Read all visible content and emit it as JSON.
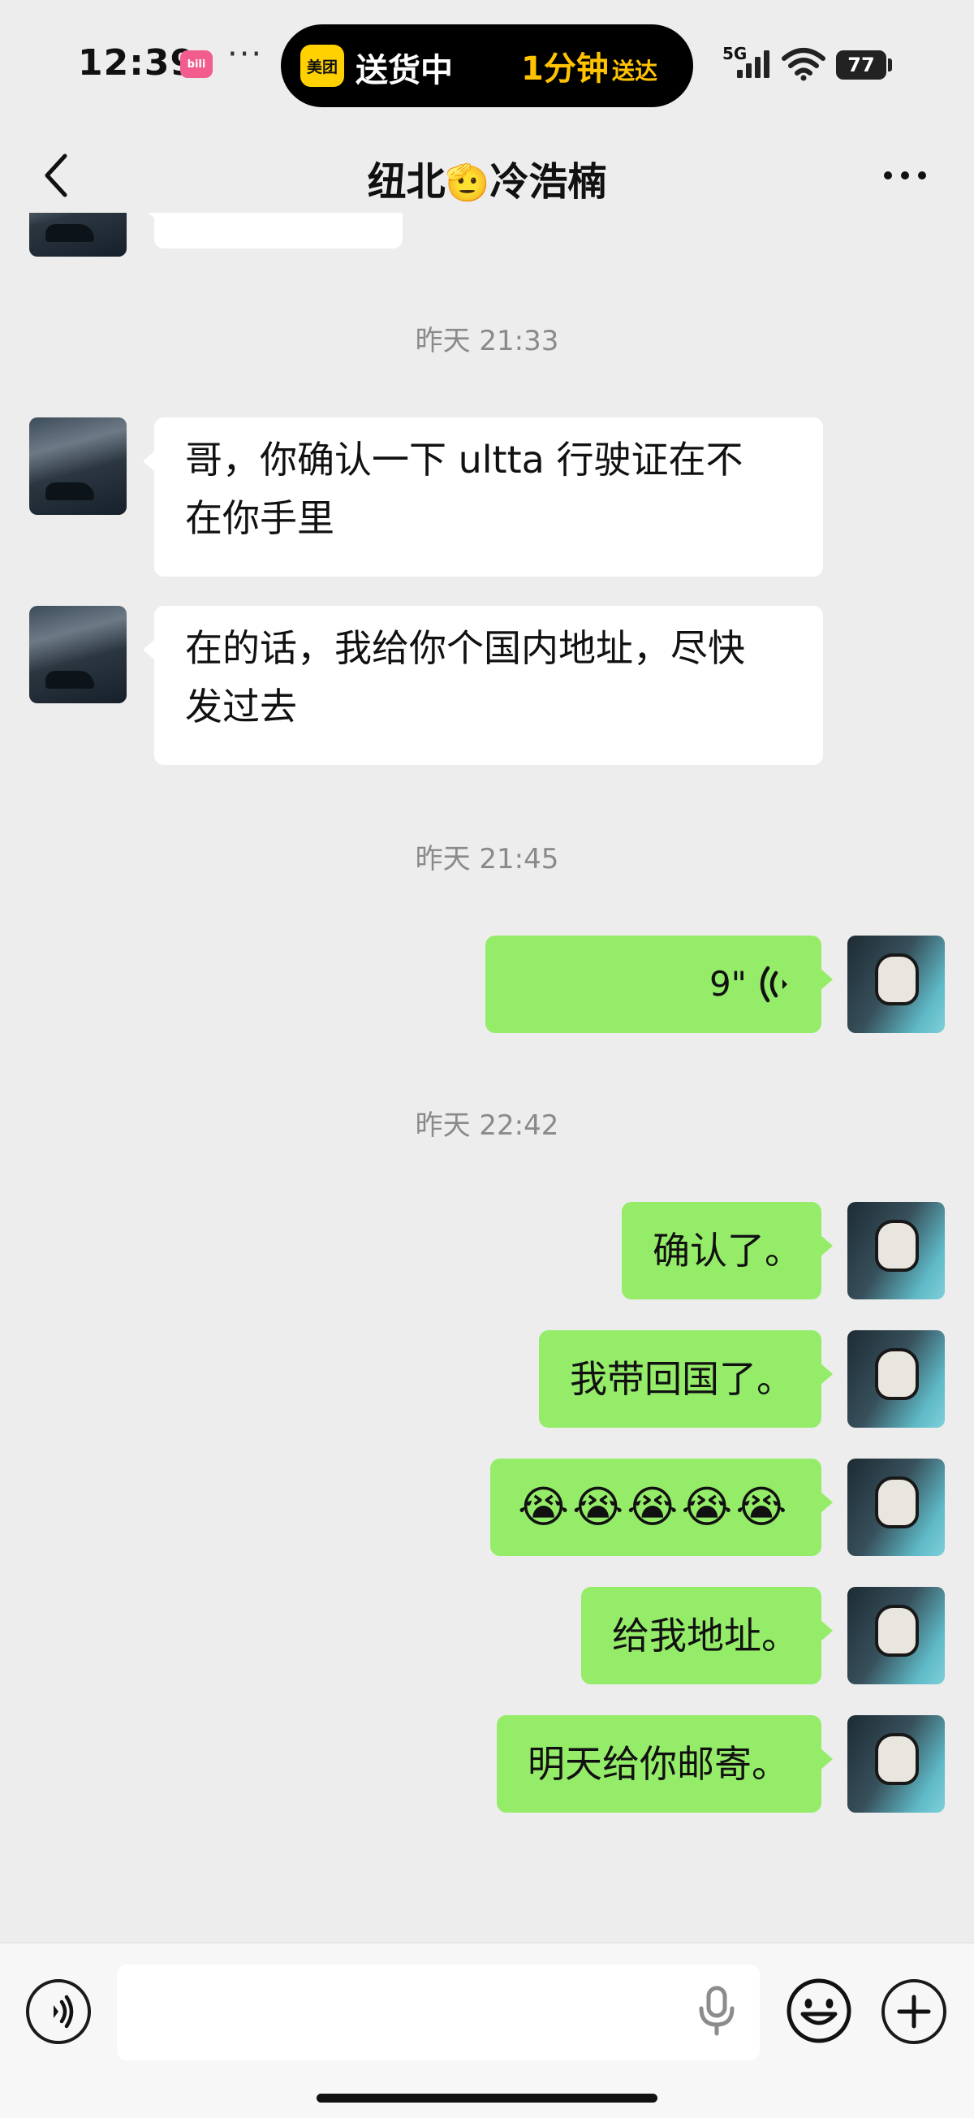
{
  "status_bar": {
    "time": "12:39",
    "app_icon_label": "bilibili",
    "more": "···",
    "island": {
      "app_icon_label": "美团",
      "status": "送货中",
      "eta": "1分钟",
      "eta_suffix": "送达"
    },
    "network": "5G",
    "battery": "77"
  },
  "nav": {
    "title_prefix": "纽北",
    "title_emoji": "🫡",
    "title_suffix": "冷浩楠",
    "back_icon": "chevron-left-icon",
    "more_icon": "more-horizontal-icon"
  },
  "messages": {
    "ts1": "昨天 21:33",
    "m1": "哥，你确认一下 ultta 行驶证在不在你手里",
    "m1_line1": "哥，你确认一下 ultta 行驶证在不",
    "m1_line2": "在你手里",
    "m2_line1": "在的话，我给你个国内地址，尽快",
    "m2_line2": "发过去",
    "ts2": "昨天 21:45",
    "voice_duration": "9\"",
    "ts3": "昨天 22:42",
    "m3": "确认了。",
    "m4": "我带回国了。",
    "m5": "😭😭😭😭😭",
    "m6": "给我地址。",
    "m7": "明天给你邮寄。"
  },
  "input_bar": {
    "value": "",
    "voice_icon": "voice-toggle-icon",
    "mic_icon": "microphone-icon",
    "emoji_icon": "emoji-icon",
    "plus_icon": "plus-icon"
  },
  "colors": {
    "background": "#ededed",
    "bubble_in": "#ffffff",
    "bubble_out": "#95ec69",
    "timestamp": "#8a8a8a",
    "eta_accent": "#ffc300"
  }
}
